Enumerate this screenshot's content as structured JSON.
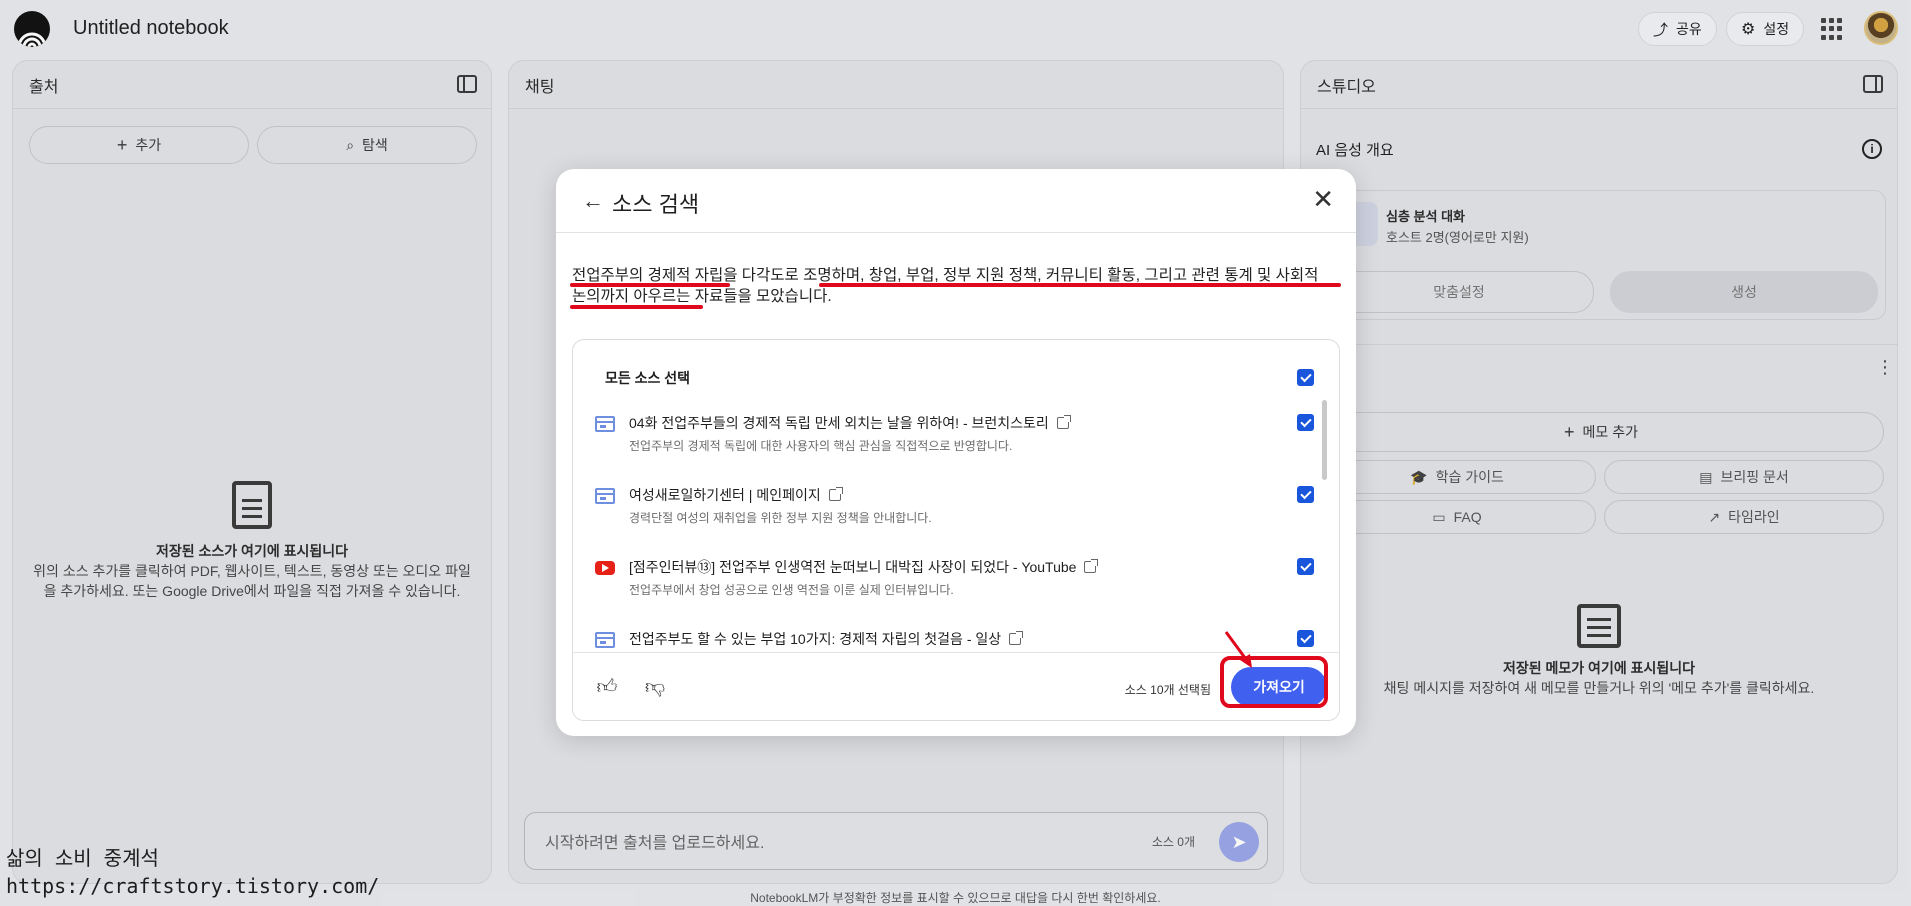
{
  "app": {
    "notebook_title": "Untitled notebook"
  },
  "header": {
    "share_label": "공유",
    "settings_label": "설정"
  },
  "sources_panel": {
    "title": "출처",
    "add_label": "추가",
    "explore_label": "탐색",
    "empty_title": "저장된 소스가 여기에 표시됩니다",
    "empty_desc_1": "위의 소스 추가를 클릭하여 PDF, 웹사이트, 텍스트, 동영상 또는 오디오 파일",
    "empty_desc_2": "을 추가하세요. 또는 Google Drive에서 파일을 직접 가져올 수 있습니다."
  },
  "chat_panel": {
    "title": "채팅",
    "input_placeholder": "시작하려면 출처를 업로드하세요.",
    "source_count": "소스 0개",
    "disclaimer": "NotebookLM가 부정확한 정보를 표시할 수 있으므로 대답을 다시 한번 확인하세요."
  },
  "studio_panel": {
    "title": "스튜디오",
    "audio_title": "AI 음성 개요",
    "deep_dive_title": "심층 분석 대화",
    "deep_dive_sub": "호스트 2명(영어로만 지원)",
    "customize_label": "맞춤설정",
    "generate_label": "생성",
    "add_memo_label": "메모 추가",
    "study_guide_label": "학습 가이드",
    "briefing_label": "브리핑 문서",
    "faq_label": "FAQ",
    "timeline_label": "타임라인",
    "empty_title": "저장된 메모가 여기에 표시됩니다",
    "empty_desc": "채팅 메시지를 저장하여 새 메모를 만들거나 위의 '메모 추가'를 클릭하세요."
  },
  "modal": {
    "title": "소스 검색",
    "summary_line1": "전업주부의 경제적 자립을 다각도로 조명하며, 창업, 부업, 정부 지원 정책, 커뮤니티 활동, 그리고 관련 통계 및 사회적",
    "summary_line2": "논의까지 아우르는 자료들을 모았습니다.",
    "select_all_label": "모든 소스 선택",
    "sources": [
      {
        "title": "04화 전업주부들의 경제적 독립 만세 외치는 날을 위하여! - 브런치스토리",
        "desc": "전업주부의 경제적 독립에 대한 사용자의 핵심 관심을 직접적으로 반영합니다.",
        "icon": "web-page-icon"
      },
      {
        "title": "여성새로일하기센터 | 메인페이지",
        "desc": "경력단절 여성의 재취업을 위한 정부 지원 정책을 안내합니다.",
        "icon": "web-page-icon"
      },
      {
        "title": "[점주인터뷰⑬] 전업주부 인생역전 눈떠보니 대박집 사장이 되었다 - YouTube",
        "desc": "전업주부에서 창업 성공으로 인생 역전을 이룬 실제 인터뷰입니다.",
        "icon": "youtube-icon"
      },
      {
        "title": "전업주부도 할 수 있는 부업 10가지: 경제적 자립의 첫걸음 - 일상",
        "desc": "",
        "icon": "web-page-icon"
      }
    ],
    "selected_count": "소스 10개 선택됨",
    "import_label": "가져오기"
  },
  "watermark": {
    "line1": "삶의 소비 중계석",
    "line2": "https://craftstory.tistory.com/"
  },
  "colors": {
    "accent": "#4060f0",
    "annotation_red": "#e0081c",
    "checkbox": "#1a56db"
  }
}
